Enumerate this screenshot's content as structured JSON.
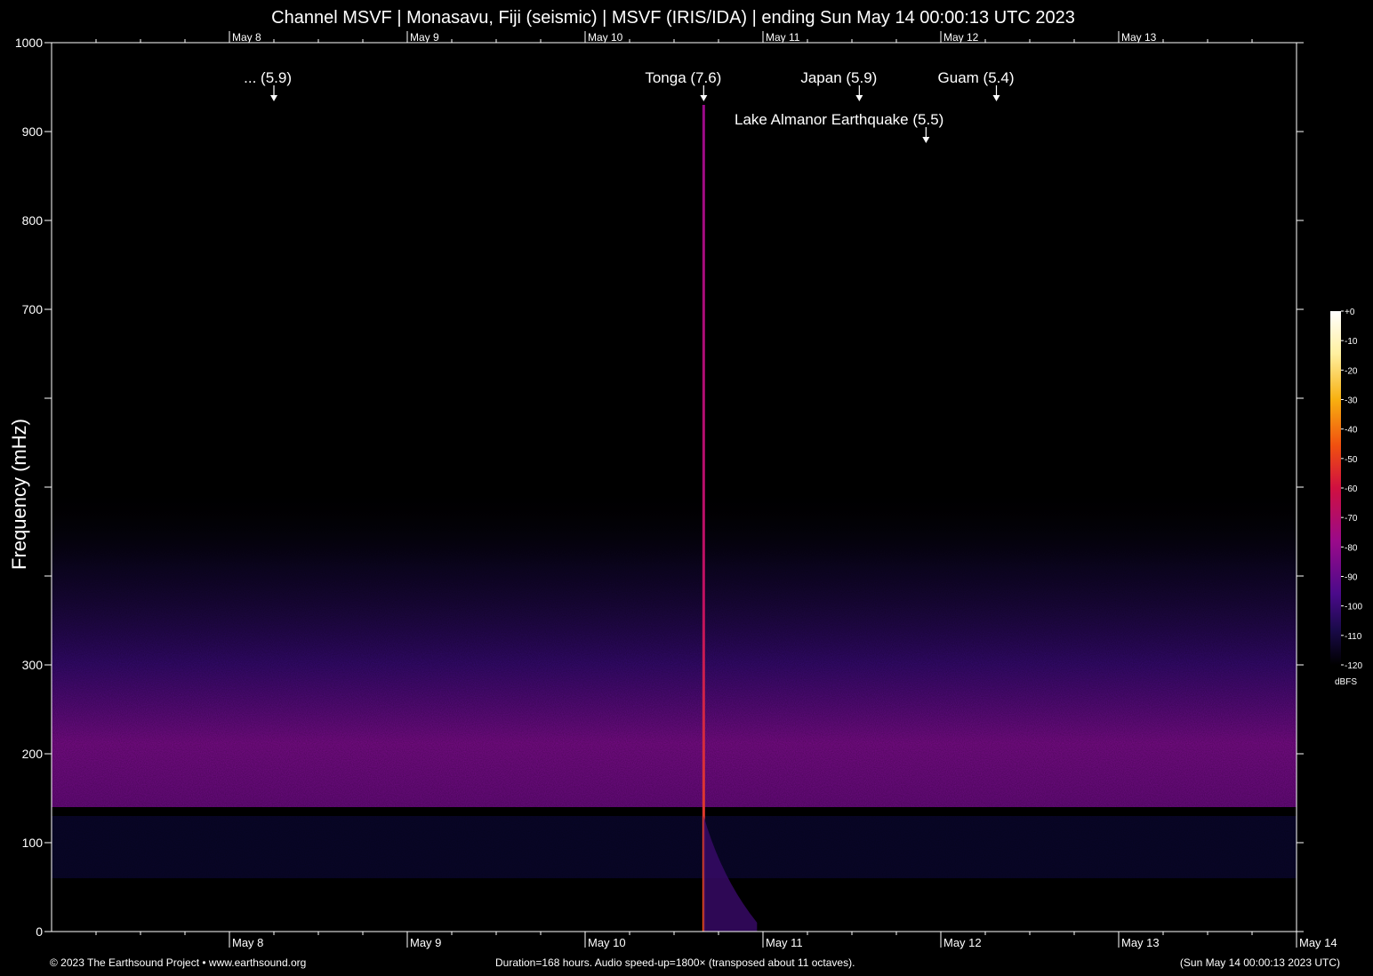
{
  "chart_data": {
    "type": "heatmap",
    "title": "Channel MSVF | Monasavu, Fiji (seismic) | MSVF (IRIS/IDA) | ending Sun May 14 00:00:13 UTC 2023",
    "xlabel": "",
    "ylabel": "Frequency (mHz)",
    "ylim": [
      0,
      1000
    ],
    "y_ticks": [
      {
        "value": 0,
        "label": "0"
      },
      {
        "value": 100,
        "label": "100"
      },
      {
        "value": 200,
        "label": "200"
      },
      {
        "value": 300,
        "label": "300"
      },
      {
        "value": 400,
        "label": ""
      },
      {
        "value": 500,
        "label": ""
      },
      {
        "value": 600,
        "label": ""
      },
      {
        "value": 700,
        "label": "700"
      },
      {
        "value": 800,
        "label": "800"
      },
      {
        "value": 900,
        "label": "900"
      },
      {
        "value": 1000,
        "label": "1000"
      }
    ],
    "xlim_hours": [
      0,
      168
    ],
    "x_ticks": [
      {
        "hour": 24,
        "label": "May 8"
      },
      {
        "hour": 48,
        "label": "May 9"
      },
      {
        "hour": 72,
        "label": "May 10"
      },
      {
        "hour": 96,
        "label": "May 11"
      },
      {
        "hour": 120,
        "label": "May 12"
      },
      {
        "hour": 144,
        "label": "May 13"
      },
      {
        "hour": 168,
        "label": "May 14"
      }
    ],
    "top_x_ticks": [
      {
        "hour": 24,
        "label": "May 8"
      },
      {
        "hour": 48,
        "label": "May 9"
      },
      {
        "hour": 72,
        "label": "May 10"
      },
      {
        "hour": 96,
        "label": "May 11"
      },
      {
        "hour": 120,
        "label": "May 12"
      },
      {
        "hour": 144,
        "label": "May 13"
      }
    ],
    "events": [
      {
        "label": "... (5.9)",
        "hour": 30,
        "row": 1
      },
      {
        "label": "Tonga (7.6)",
        "hour": 88,
        "row": 1
      },
      {
        "label": "Japan (5.9)",
        "hour": 109,
        "row": 1
      },
      {
        "label": "Guam (5.4)",
        "hour": 127.5,
        "row": 1
      },
      {
        "label": "Lake Almanor Earthquake (5.5)",
        "hour": 118,
        "row": 2
      }
    ],
    "colorbar": {
      "unit": "dBFS",
      "ticks": [
        {
          "value": 0,
          "label": "+0"
        },
        {
          "value": -10,
          "label": "-10"
        },
        {
          "value": -20,
          "label": "-20"
        },
        {
          "value": -30,
          "label": "-30"
        },
        {
          "value": -40,
          "label": "-40"
        },
        {
          "value": -50,
          "label": "-50"
        },
        {
          "value": -60,
          "label": "-60"
        },
        {
          "value": -70,
          "label": "-70"
        },
        {
          "value": -80,
          "label": "-80"
        },
        {
          "value": -90,
          "label": "-90"
        },
        {
          "value": -100,
          "label": "-100"
        },
        {
          "value": -110,
          "label": "-110"
        },
        {
          "value": -120,
          "label": "-120"
        }
      ],
      "colors": [
        "#000000",
        "#1a0a4a",
        "#4a0a8a",
        "#9a0a8a",
        "#d01040",
        "#f05010",
        "#f8b010",
        "#fff0a0",
        "#ffffff"
      ]
    },
    "background_color": "#000000",
    "foreground_color": "#ffffff"
  },
  "footer": {
    "left": "© 2023 The Earthsound Project • www.earthsound.org",
    "center": "Duration=168 hours. Audio speed-up=1800× (transposed about 11 octaves).",
    "right": "(Sun May 14 00:00:13 2023 UTC)"
  }
}
